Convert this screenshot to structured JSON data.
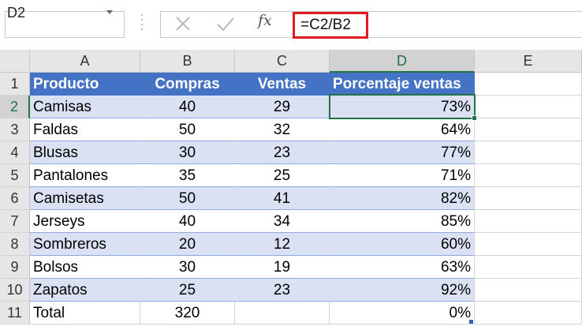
{
  "name_box": {
    "value": "D2"
  },
  "formula_bar": {
    "cancel_icon": "x-icon",
    "enter_icon": "checkmark-icon",
    "insert_function_label": "fx",
    "formula": "=C2/B2",
    "highlight_color": "#e01b24"
  },
  "columns": [
    "A",
    "B",
    "C",
    "D",
    "E"
  ],
  "rows": [
    "1",
    "2",
    "3",
    "4",
    "5",
    "6",
    "7",
    "8",
    "9",
    "10",
    "11"
  ],
  "selected_cell": "D2",
  "table": {
    "header_color": "#4472c4",
    "band_color": "#d9e1f2",
    "headers": [
      "Producto",
      "Compras",
      "Ventas",
      "Porcentaje ventas"
    ],
    "body": [
      [
        "Camisas",
        "40",
        "29",
        "73%"
      ],
      [
        "Faldas",
        "50",
        "32",
        "64%"
      ],
      [
        "Blusas",
        "30",
        "23",
        "77%"
      ],
      [
        "Pantalones",
        "35",
        "25",
        "71%"
      ],
      [
        "Camisetas",
        "50",
        "41",
        "82%"
      ],
      [
        "Jerseys",
        "40",
        "34",
        "85%"
      ],
      [
        "Sombreros",
        "20",
        "12",
        "60%"
      ],
      [
        "Bolsos",
        "30",
        "19",
        "63%"
      ],
      [
        "Zapatos",
        "25",
        "23",
        "92%"
      ]
    ],
    "total": [
      "Total",
      "320",
      "",
      "0%"
    ]
  }
}
